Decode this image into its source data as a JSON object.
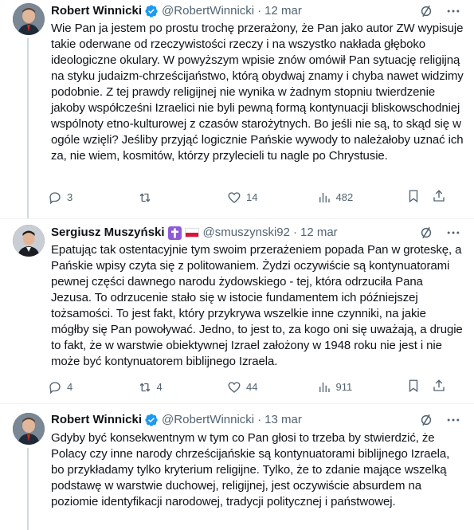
{
  "colors": {
    "verified_badge": "#1d9bf0",
    "secondary_text": "#536471",
    "thread_line": "#cfd9de"
  },
  "tweets": [
    {
      "author": "Robert Winnicki",
      "handle": "@RobertWinnicki",
      "date": "12 mar",
      "verified": true,
      "text": "Wie Pan ja jestem po prostu trochę przerażony, że Pan jako autor ZW wypisuje takie oderwane od rzeczywistości rzeczy i na wszystko nakłada głęboko ideologiczne okulary. W powyższym wpisie znów omówił Pan sytuację religijną na styku judaizm-chrześcijaństwo, którą obydwaj znamy i chyba nawet widzimy podobnie. Z tej prawdy religijnej nie wynika w żadnym stopniu twierdzenie jakoby współcześni Izraelici nie byli pewną formą kontynuacji bliskowschodniej wspólnoty etno-kulturowej z czasów starożytnych. Bo jeśli nie są, to skąd się w ogóle wzięli? Jeśliby przyjąć logicznie Pańskie wywody to należałoby uznać ich za, nie wiem, kosmitów, którzy przylecieli tu nagle po Chrystusie.",
      "replies": "3",
      "retweets": "",
      "likes": "14",
      "views": "482"
    },
    {
      "author": "Sergiusz Muszyński",
      "handle": "@smuszynski92",
      "date": "12 mar",
      "verified": false,
      "emoji_names": [
        "latin-cross-emoji",
        "poland-flag-emoji"
      ],
      "text": "Epatując tak ostentacyjnie tym swoim przerażeniem popada Pan w groteskę, a Pańskie wpisy czyta się z politowaniem. Żydzi oczywiście są kontynuatorami pewnej części dawnego narodu żydowskiego - tej, która odrzuciła Pana Jezusa. To odrzucenie stało się w istocie fundamentem ich późniejszej tożsamości. To jest fakt, który przykrywa wszelkie inne czynniki, na jakie mógłby się Pan powoływać. Jedno, to jest to, za kogo oni się uważają, a drugie to fakt, że w warstwie obiektywnej Izrael założony w 1948 roku nie jest i nie może być kontynuatorem biblijnego Izraela.",
      "replies": "4",
      "retweets": "4",
      "likes": "44",
      "views": "911"
    },
    {
      "author": "Robert Winnicki",
      "handle": "@RobertWinnicki",
      "date": "13 mar",
      "verified": true,
      "text": "Gdyby być konsekwentnym w tym co Pan głosi to trzeba by stwierdzić, że Polacy czy inne narody chrześcijańskie są kontynuatorami biblijnego Izraela, bo przykładamy tylko kryterium religijne. Tylko, że to zdanie mające wszelką podstawę w warstwie duchowej, religijnej, jest oczywiście absurdem na poziomie identyfikacji narodowej, tradycji politycznej i państwowej."
    }
  ]
}
